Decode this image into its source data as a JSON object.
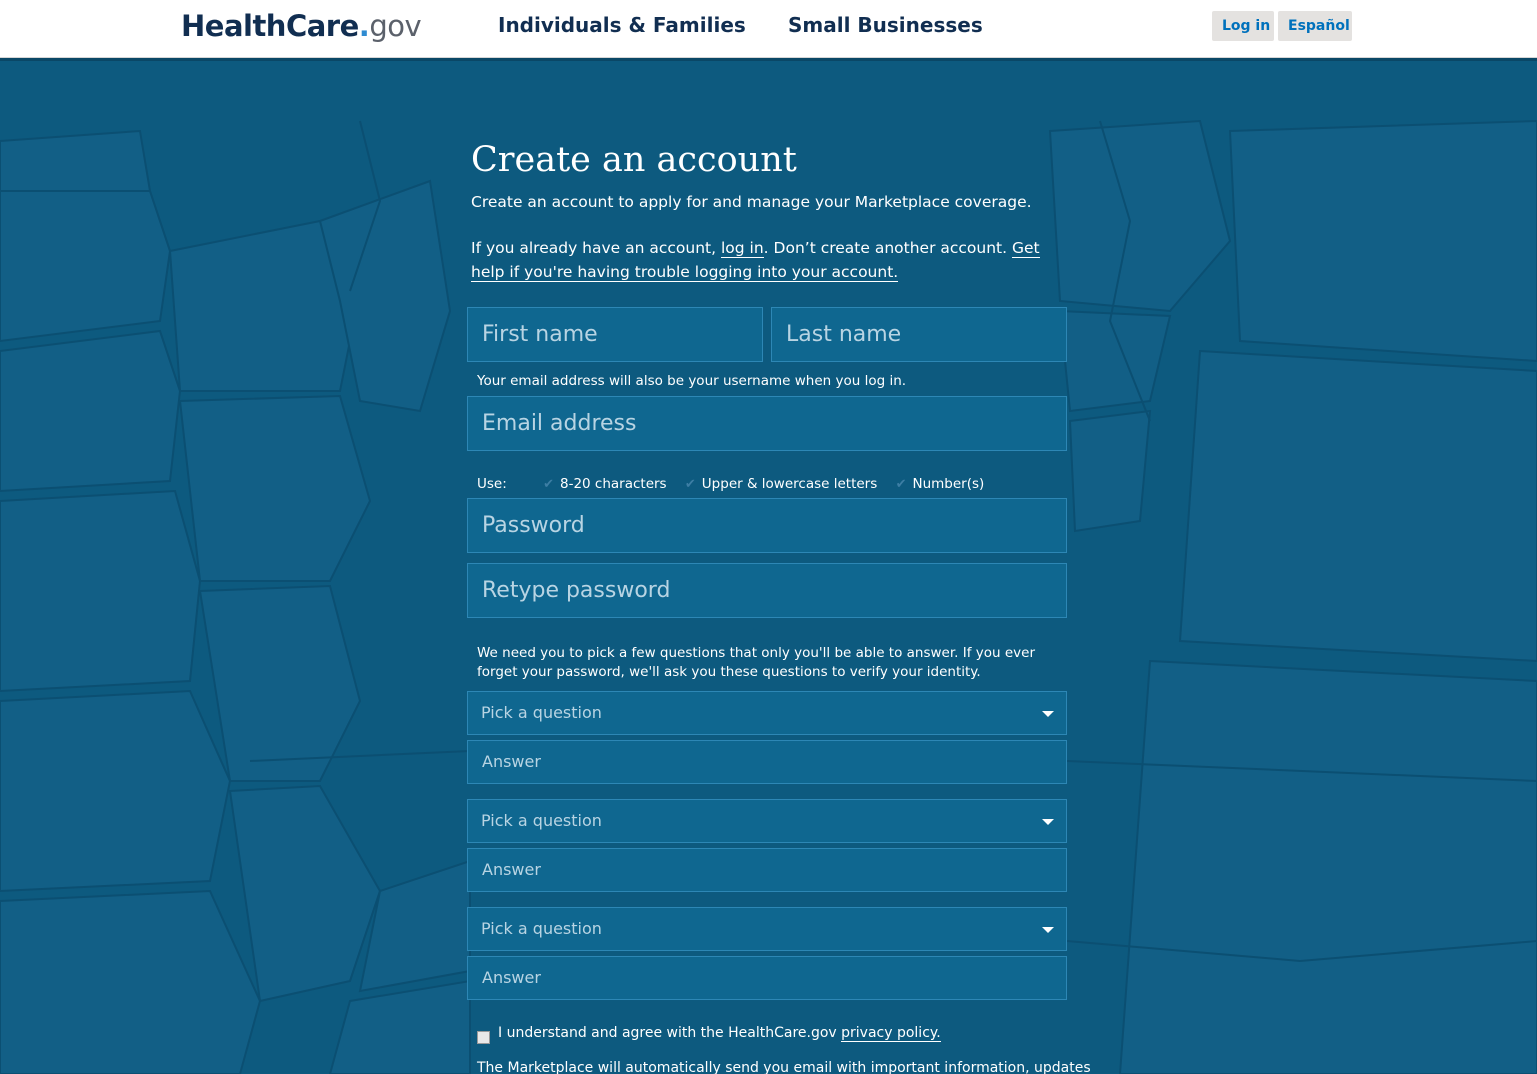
{
  "header": {
    "logo": {
      "health": "HealthCare",
      "dot": ".",
      "gov": "gov"
    },
    "nav": [
      {
        "label": "Individuals & Families"
      },
      {
        "label": "Small Businesses"
      }
    ],
    "login_label": "Log in",
    "espanol_label": "Español"
  },
  "form": {
    "title": "Create an account",
    "subtitle": "Create an account to apply for and manage your Marketplace coverage.",
    "already": {
      "prefix": "If you already have an account, ",
      "login_link": "log in",
      "middle": ". Don’t create another account. ",
      "help_link": "Get help if you're having trouble logging into your account."
    },
    "first_name_placeholder": "First name",
    "last_name_placeholder": "Last name",
    "email_hint": "Your email address will also be your username when you log in.",
    "email_placeholder": "Email address",
    "password_rules": {
      "label": "Use:",
      "rules": [
        "8-20 characters",
        "Upper & lowercase letters",
        "Number(s)"
      ]
    },
    "password_placeholder": "Password",
    "retype_placeholder": "Retype password",
    "security_note": "We need you to pick a few questions that only you'll be able to answer. If you ever forget your password, we'll ask you these questions to verify your identity.",
    "questions": [
      {
        "select": "Pick a question",
        "answer": "Answer"
      },
      {
        "select": "Pick a question",
        "answer": "Answer"
      },
      {
        "select": "Pick a question",
        "answer": "Answer"
      }
    ],
    "agree_text": "I understand and agree with the HealthCare.gov ",
    "privacy_link": "privacy policy.",
    "marketplace_note": "The Marketplace will automatically send you email with important information, updates"
  },
  "colors": {
    "background": "#0d5a7f",
    "input_bg": "#0f6790",
    "header_bg": "#ffffff",
    "brand_navy": "#112e51",
    "link_blue": "#0071bc"
  }
}
